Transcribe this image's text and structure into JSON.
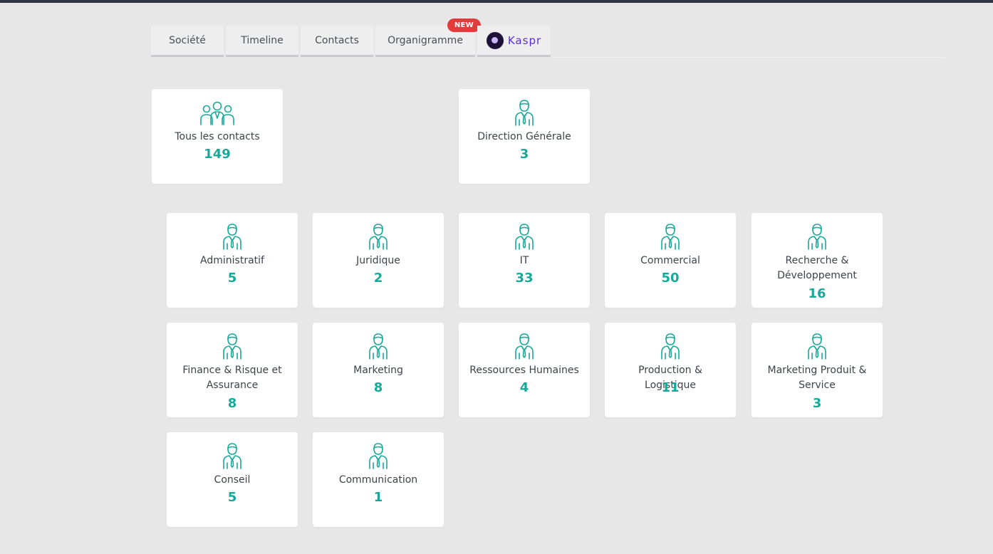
{
  "tabs": [
    {
      "label": "Société"
    },
    {
      "label": "Timeline"
    },
    {
      "label": "Contacts"
    },
    {
      "label": "Organigramme",
      "badge": "NEW"
    },
    {
      "label": "Kaspr",
      "icon": "kaspr-logo-icon"
    }
  ],
  "top_cards": [
    {
      "label": "Tous les contacts",
      "count": "149",
      "icon": "group-icon"
    },
    {
      "label": "Direction Générale",
      "count": "3",
      "icon": "person-icon"
    }
  ],
  "departments": [
    {
      "label": "Administratif",
      "count": "5"
    },
    {
      "label": "Juridique",
      "count": "2"
    },
    {
      "label": "IT",
      "count": "33"
    },
    {
      "label": "Commercial",
      "count": "50"
    },
    {
      "label": "Recherche & Développement",
      "count": "16"
    },
    {
      "label": "Finance & Risque et Assurance",
      "count": "8"
    },
    {
      "label": "Marketing",
      "count": "8"
    },
    {
      "label": "Ressources Humaines",
      "count": "4"
    },
    {
      "label": "Production & Logistique",
      "count": "11"
    },
    {
      "label": "Marketing Produit & Service",
      "count": "3"
    },
    {
      "label": "Conseil",
      "count": "5"
    },
    {
      "label": "Communication",
      "count": "1"
    }
  ],
  "colors": {
    "accent": "#16a99a",
    "badge": "#e23b3b",
    "kaspr": "#5a2ed8"
  }
}
